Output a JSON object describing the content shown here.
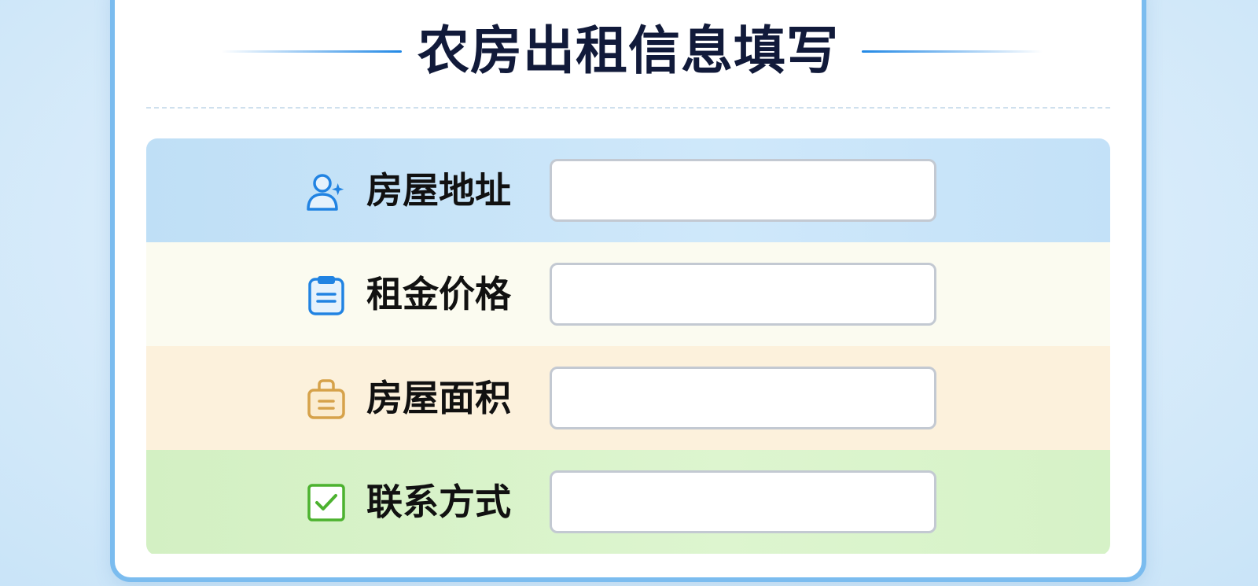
{
  "form": {
    "title": "农房出租信息填写",
    "fields": [
      {
        "label": "房屋地址",
        "icon": "user-icon",
        "value": "",
        "placeholder": ""
      },
      {
        "label": "租金价格",
        "icon": "clipboard-icon",
        "value": "",
        "placeholder": ""
      },
      {
        "label": "房屋面积",
        "icon": "briefcase-icon",
        "value": "",
        "placeholder": ""
      },
      {
        "label": "联系方式",
        "icon": "checkbox-icon",
        "value": "",
        "placeholder": ""
      }
    ]
  },
  "colors": {
    "accent": "#2188e5",
    "card_border": "#7bbcef",
    "title": "#111a3a",
    "row_1": "#c8e4f8",
    "row_2": "#fbfbf0",
    "row_3": "#fcf1dc",
    "row_4": "#d8f2c9",
    "icon_user": "#2183e2",
    "icon_clipboard": "#2183e2",
    "icon_briefcase": "#d6a24a",
    "icon_checkbox": "#4cb22f"
  }
}
